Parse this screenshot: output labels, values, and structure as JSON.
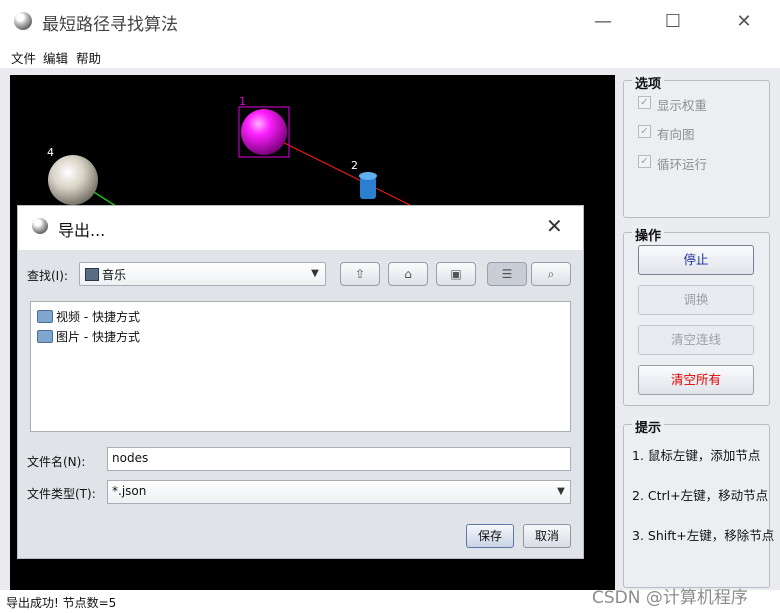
{
  "window": {
    "title": "最短路径寻找算法",
    "minimize_glyph": "—",
    "maximize_glyph": "☐",
    "close_glyph": "✕"
  },
  "menu": [
    "文件",
    "编辑",
    "帮助"
  ],
  "canvas": {
    "nodes": [
      {
        "label": "1",
        "color": "#e000e0",
        "icon": "magenta-sphere"
      },
      {
        "label": "2",
        "color": "#2a7fd0",
        "icon": "trash-can-icon"
      },
      {
        "label": "4",
        "color": "#d8d2c6",
        "icon": "pearl-sphere"
      }
    ],
    "edge_colors": {
      "red": "#ff1a1a",
      "green": "#19c219"
    }
  },
  "options": {
    "title": "选项",
    "checks": [
      {
        "label": "显示权重",
        "checked": true
      },
      {
        "label": "有向图",
        "checked": true
      },
      {
        "label": "循环运行",
        "checked": true
      }
    ]
  },
  "operations": {
    "title": "操作",
    "stop": "停止",
    "toggle": "调换",
    "clear_lines": "清空连线",
    "clear_all": "清空所有"
  },
  "hints": {
    "title": "提示",
    "lines": [
      "1. 鼠标左键，添加节点",
      "2. Ctrl+左键，移动节点",
      "3. Shift+左键，移除节点"
    ]
  },
  "status": "导出成功! 节点数=5",
  "watermark": "CSDN @计算机程序",
  "dialog": {
    "title": "导出...",
    "lookin_label": "查找(I):",
    "lookin_value": "音乐",
    "files": [
      "视频 - 快捷方式",
      "图片 - 快捷方式"
    ],
    "filename_label": "文件名(N):",
    "filename_value": "nodes",
    "filetype_label": "文件类型(T):",
    "filetype_value": "*.json",
    "save": "保存",
    "cancel": "取消",
    "close_glyph": "✕"
  }
}
